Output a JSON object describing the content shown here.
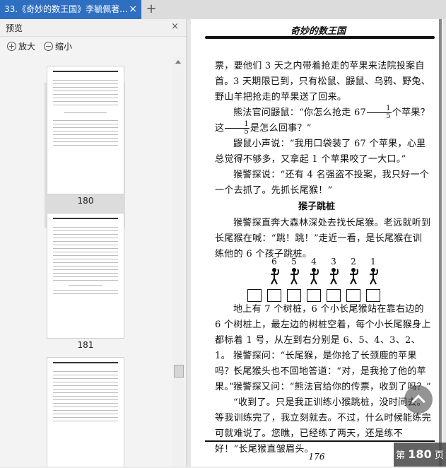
{
  "tab": {
    "title": "33.《奇妙的数王国》李毓佩著...",
    "close": "×",
    "new_tab": "+"
  },
  "sidebar": {
    "title": "预览",
    "close": "×",
    "zoom_in": "放大",
    "zoom_out": "缩小",
    "thumbnails": [
      {
        "page_label": "180",
        "selected": true
      },
      {
        "page_label": "181",
        "selected": false
      },
      {
        "page_label": "",
        "selected": false
      }
    ]
  },
  "page": {
    "running_head": "奇妙的数王国",
    "paragraphs": [
      "票，要他们 3 天之内带着抢走的苹果来法院投案自首。",
      "3 天期限已到，只有松鼠、鼹鼠、乌鸦、野兔、野山羊把抢走的苹果送了回来。",
      "熊法官问鼹鼠：“你怎么抢走 67",
      "个苹果？这",
      "是怎么回事？”",
      "鼹鼠小声说：“我用口袋装了 67 个苹果，心里总觉得不够多，又拿起 1 个苹果咬了一大口。”",
      "猴警探说：“还有 4 名强盗不投案，我只好一个一个去抓了。先抓长尾猴！”"
    ],
    "frac_a": {
      "num": "1",
      "den": "5"
    },
    "frac_b": {
      "num": "1",
      "den": "5"
    },
    "section_title": "猴子跳桩",
    "paragraphs2": [
      "猴警探直奔大森林深处去找长尾猴。老远就听到长尾猴在喊：“跳！跳！”走近一看，是长尾猴在训练他的 6 个孩子跳桩。",
      "地上有 7 个树桩，6 个小长尾猴站在靠右边的 6 个树桩上，最左边的树桩空着，每个小长尾猴身上都标着 1 号，从左到右分别是 6、5、4、3、2、1。",
      "猴警探问：“长尾猴，是你抢了长颈鹿的苹果吗？”",
      "长尾猴头也不回地答道：“对，是我抢了他的苹果。”",
      "猴警探又问：“熊法官给你的传票，收到了吗？”",
      "“收到了。只是我正训练小猴跳桩，没时间去。等我训练完了，我立刻就去。不过，什么时候能练完可就难说了。您瞧，已经练了两天，还是练不好！”长尾猴直皱眉头。"
    ],
    "monkey_numbers": [
      "6",
      "5",
      "4",
      "3",
      "2",
      "1"
    ],
    "folio": "176"
  },
  "badge": {
    "prefix": "第",
    "number": "180",
    "suffix": "页"
  }
}
